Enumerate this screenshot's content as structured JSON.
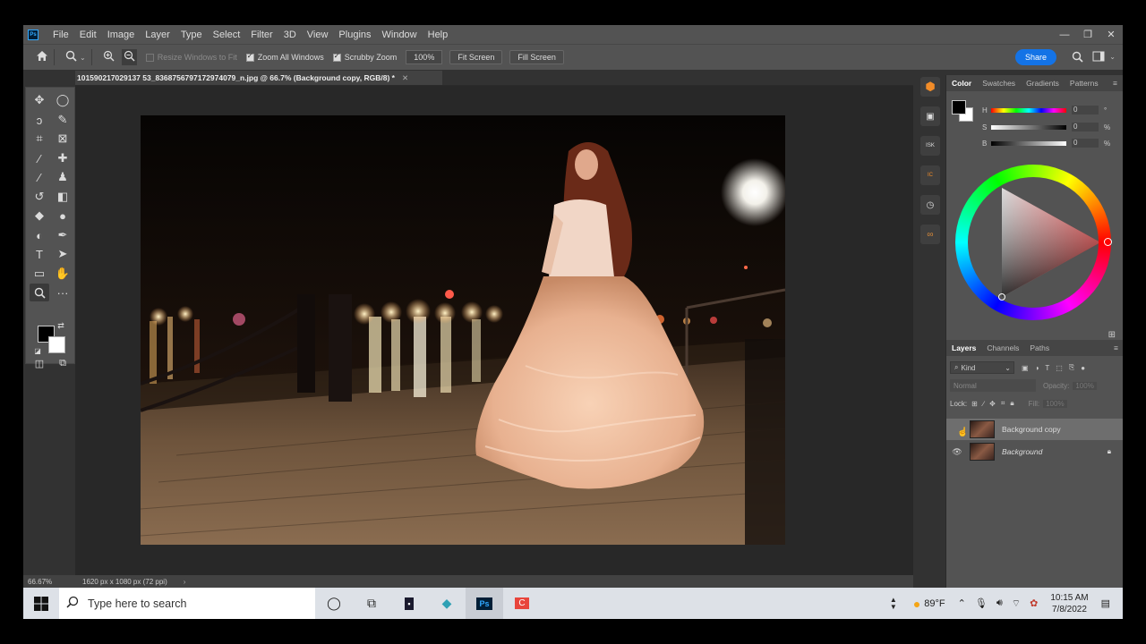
{
  "menu": [
    "File",
    "Edit",
    "Image",
    "Layer",
    "Type",
    "Select",
    "Filter",
    "3D",
    "View",
    "Plugins",
    "Window",
    "Help"
  ],
  "options": {
    "resize_windows": "Resize Windows to Fit",
    "zoom_all": "Zoom All Windows",
    "scrubby": "Scrubby Zoom",
    "zoom_value": "100%",
    "fit_screen": "Fit Screen",
    "fill_screen": "Fill Screen",
    "share": "Share"
  },
  "doc_tab": "101590217029137​53_836875679717297​4079_n.jpg @ 66.7% (Background copy, RGB/8) *",
  "doc_tab_clean": "101590217029137 53_8368756797172974079_n.jpg @ 66.7% (Background copy, RGB/8) *",
  "status": {
    "zoom": "66.67%",
    "doc_info": "1620 px x 1080 px (72 ppi)"
  },
  "color_panel": {
    "tabs": [
      "Color",
      "Swatches",
      "Gradients",
      "Patterns"
    ],
    "h": "H",
    "s": "S",
    "b": "B",
    "h_val": "0",
    "s_val": "0",
    "b_val": "0",
    "deg": "°",
    "pct": "%",
    "accent_red": "#ff0000"
  },
  "layers_panel": {
    "tabs": [
      "Layers",
      "Channels",
      "Paths"
    ],
    "kind": "Kind",
    "blend": "Normal",
    "opacity_label": "Opacity:",
    "opacity_val": "100%",
    "lock_label": "Lock:",
    "fill_label": "Fill:",
    "fill_val": "100%",
    "layers": [
      "Background copy",
      "Background"
    ]
  },
  "taskbar": {
    "search_placeholder": "Type here to search",
    "temp": "89°F",
    "time": "10:15 AM",
    "date": "7/8/2022"
  }
}
